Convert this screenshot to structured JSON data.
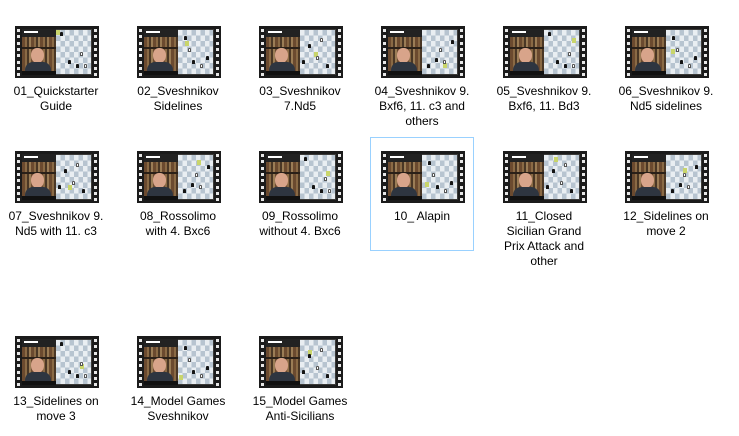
{
  "files": [
    {
      "name": "01_Quickstarter Guide",
      "lines": [
        "01_Quickstarter",
        "Guide"
      ],
      "selected": false
    },
    {
      "name": "02_Sveshnikov Sidelines",
      "lines": [
        "02_Sveshnikov",
        "Sidelines"
      ],
      "selected": false
    },
    {
      "name": "03_Sveshnikov 7.Nd5",
      "lines": [
        "03_Sveshnikov",
        "7.Nd5"
      ],
      "selected": false
    },
    {
      "name": "04_Sveshnikov 9. Bxf6, 11. c3 and others",
      "lines": [
        "04_Sveshnikov 9.",
        "Bxf6, 11. c3 and",
        "others"
      ],
      "selected": false
    },
    {
      "name": "05_Sveshnikov 9. Bxf6, 11. Bd3",
      "lines": [
        "05_Sveshnikov 9.",
        "Bxf6, 11. Bd3"
      ],
      "selected": false
    },
    {
      "name": "06_Sveshnikov 9. Nd5 sidelines",
      "lines": [
        "06_Sveshnikov 9.",
        "Nd5 sidelines"
      ],
      "selected": false
    },
    {
      "name": "07_Sveshnikov 9. Nd5 with 11. c3",
      "lines": [
        "07_Sveshnikov 9.",
        "Nd5 with 11. c3"
      ],
      "selected": false
    },
    {
      "name": "08_Rossolimo with 4. Bxc6",
      "lines": [
        "08_Rossolimo",
        "with 4. Bxc6"
      ],
      "selected": false
    },
    {
      "name": "09_Rossolimo without 4. Bxc6",
      "lines": [
        "09_Rossolimo",
        "without 4. Bxc6"
      ],
      "selected": false
    },
    {
      "name": "10_ Alapin",
      "lines": [
        "10_ Alapin"
      ],
      "selected": true
    },
    {
      "name": "11_Closed Sicilian Grand Prix Attack and other",
      "lines": [
        "11_Closed",
        "Sicilian  Grand",
        "Prix Attack and",
        "other"
      ],
      "selected": false
    },
    {
      "name": "12_Sidelines on move 2",
      "lines": [
        "12_Sidelines on",
        "move 2"
      ],
      "selected": false
    },
    {
      "name": "13_Sidelines on move 3",
      "lines": [
        "13_Sidelines on",
        "move 3"
      ],
      "selected": false
    },
    {
      "name": "14_Model Games Sveshnikov",
      "lines": [
        "14_Model Games",
        "Sveshnikov"
      ],
      "selected": false
    },
    {
      "name": "15_Model Games Anti-Sicilians",
      "lines": [
        "15_Model Games",
        "Anti-Sicilians"
      ],
      "selected": false
    }
  ],
  "icons": {
    "file_thumbnail": "video-file-icon"
  },
  "colors": {
    "selection_border": "#99d1ff",
    "hover_bg": "#e5f3ff"
  }
}
